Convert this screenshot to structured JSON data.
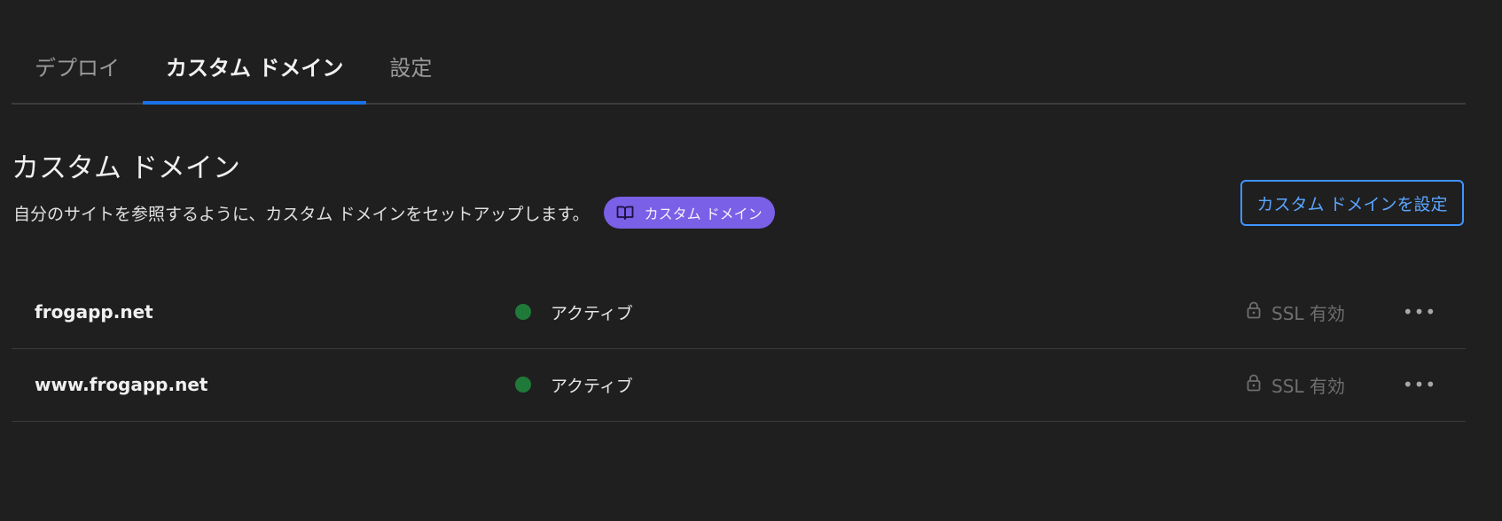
{
  "tabs": [
    {
      "label": "デプロイ",
      "active": false
    },
    {
      "label": "カスタム ドメイン",
      "active": true
    },
    {
      "label": "設定",
      "active": false
    }
  ],
  "section": {
    "title": "カスタム ドメイン",
    "description": "自分のサイトを参照するように、カスタム ドメインをセットアップします。",
    "doc_chip": {
      "label": "カスタム ドメイン",
      "icon": "book-icon"
    },
    "setup_button": "カスタム ドメインを設定"
  },
  "domains": [
    {
      "name": "frogapp.net",
      "status": "アクティブ",
      "ssl": "SSL 有効"
    },
    {
      "name": "www.frogapp.net",
      "status": "アクティブ",
      "ssl": "SSL 有効"
    }
  ],
  "more_glyph": "•••",
  "colors": {
    "background": "#1f1f1f",
    "accent_blue": "#1a73e8",
    "chip_purple": "#7a60e6",
    "status_active": "#1f7a3a"
  }
}
